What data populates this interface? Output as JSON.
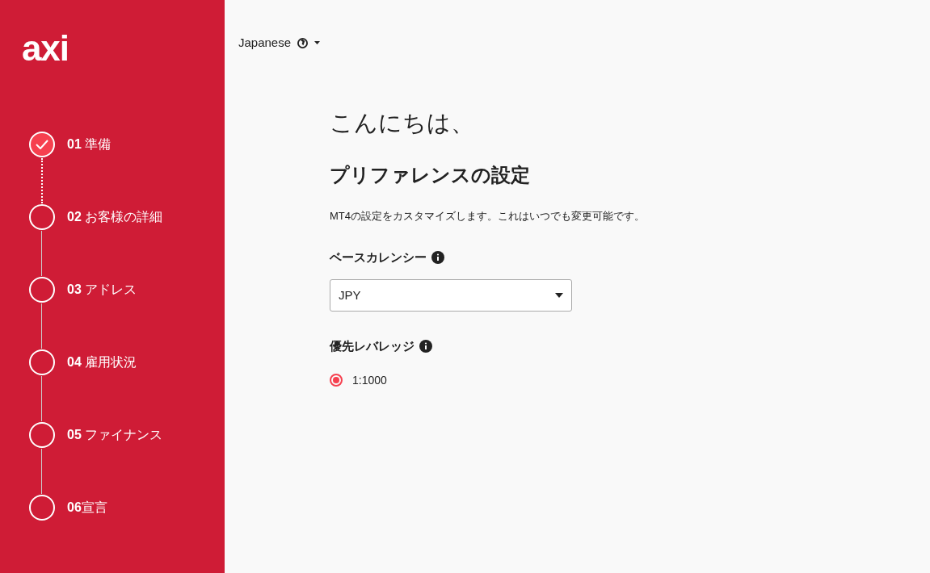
{
  "sidebar": {
    "logo": "axi",
    "steps": [
      {
        "label": "**01** 準備",
        "completed": true
      },
      {
        "label": "**02** お客様の詳細",
        "completed": false
      },
      {
        "label": "**03** アドレス",
        "completed": false
      },
      {
        "label": "**04** 雇用状況",
        "completed": false
      },
      {
        "label": "**05** ファイナンス",
        "completed": false
      },
      {
        "label": "**06**宣言",
        "completed": false
      }
    ]
  },
  "language_selector": {
    "label": "Japanese"
  },
  "greeting": "こんにちは、",
  "heading": "プリファレンスの設定",
  "description": "MT4の設定をカスタマイズします。これはいつでも変更可能です。",
  "base_currency": {
    "label": "ベースカレンシー",
    "value": "JPY"
  },
  "leverage": {
    "label": "優先レバレッジ",
    "options": [
      {
        "label": "1:1000",
        "selected": true
      }
    ]
  }
}
